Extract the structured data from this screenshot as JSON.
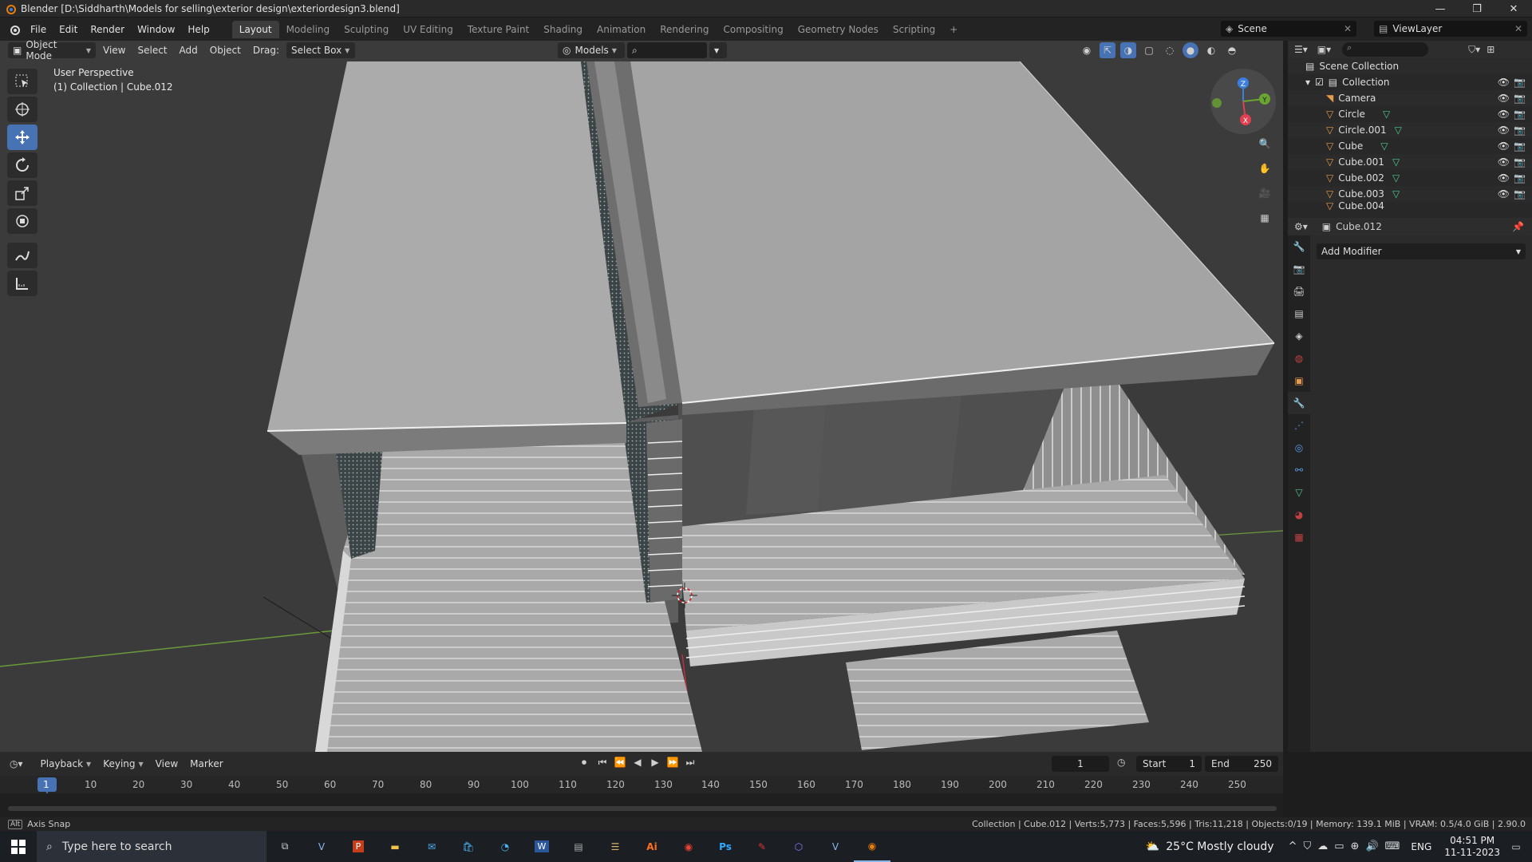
{
  "window": {
    "title": "Blender [D:\\Siddharth\\Models for selling\\exterior design\\exteriordesign3.blend]",
    "controls": [
      "—",
      "❐",
      "✕"
    ]
  },
  "menu": {
    "items": [
      "File",
      "Edit",
      "Render",
      "Window",
      "Help"
    ]
  },
  "workspaces": {
    "tabs": [
      "Layout",
      "Modeling",
      "Sculpting",
      "UV Editing",
      "Texture Paint",
      "Shading",
      "Animation",
      "Rendering",
      "Compositing",
      "Geometry Nodes",
      "Scripting"
    ],
    "add": "+"
  },
  "scene": {
    "name": "Scene",
    "view_layer": "ViewLayer"
  },
  "viewport_header": {
    "mode": "Object Mode",
    "view": "View",
    "select": "Select",
    "add": "Add",
    "object": "Object",
    "drag_label": "Drag:",
    "drag_value": "Select Box",
    "orientation": "Models"
  },
  "viewport": {
    "perspective": "User Perspective",
    "context": "(1) Collection | Cube.012"
  },
  "gizmo_axes": {
    "x": "X",
    "y": "Y",
    "z": "Z"
  },
  "outliner": {
    "root": "Scene Collection",
    "collection": "Collection",
    "items": [
      "Camera",
      "Circle",
      "Circle.001",
      "Cube",
      "Cube.001",
      "Cube.002",
      "Cube.003",
      "Cube.004"
    ]
  },
  "properties": {
    "object_name": "Cube.012",
    "add_modifier": "Add Modifier"
  },
  "timeline": {
    "playback": "Playback",
    "keying": "Keying",
    "view": "View",
    "marker": "Marker",
    "current_frame": "1",
    "start_label": "Start",
    "start": "1",
    "end_label": "End",
    "end": "250",
    "ticks": [
      "1",
      "10",
      "20",
      "30",
      "40",
      "50",
      "60",
      "70",
      "80",
      "90",
      "100",
      "110",
      "120",
      "130",
      "140",
      "150",
      "160",
      "170",
      "180",
      "190",
      "200",
      "210",
      "220",
      "230",
      "240",
      "250"
    ]
  },
  "statusbar": {
    "left": "Axis Snap",
    "right": "Collection | Cube.012 | Verts:5,773 | Faces:5,596 | Tris:11,218 | Objects:0/19 | Memory: 139.1 MiB | VRAM: 0.5/4.0 GiB | 2.90.0"
  },
  "taskbar": {
    "search_placeholder": "Type here to search",
    "weather": "25°C  Mostly cloudy",
    "lang": "ENG",
    "time": "04:51 PM",
    "date": "11-11-2023"
  },
  "colors": {
    "accent": "#4772b3",
    "x_axis": "#e0404f",
    "y_axis": "#6aa431",
    "z_axis": "#3b7fe0"
  }
}
